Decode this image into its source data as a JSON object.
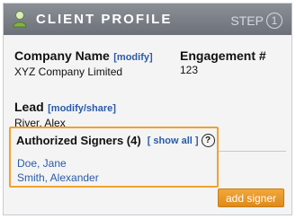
{
  "header": {
    "title": "CLIENT PROFILE",
    "step_label": "STEP",
    "step_number": "1"
  },
  "company": {
    "label": "Company Name",
    "link": "[modify]",
    "value": "XYZ Company Limited"
  },
  "engagement": {
    "label": "Engagement #",
    "value": "123"
  },
  "lead": {
    "label": "Lead",
    "link": "[modify/share]",
    "value": "River, Alex"
  },
  "signers": {
    "label": "Authorized Signers (4)",
    "show_all": "[ show all ]",
    "help": "?",
    "items": [
      "Doe, Jane",
      "Smith, Alexander"
    ]
  },
  "actions": {
    "add_signer": "add signer"
  },
  "colors": {
    "header_bg": "#6c7179",
    "link": "#2b5aa8",
    "accent": "#f0a22e",
    "button": "#e4921f"
  },
  "icons": {
    "header_icon": "user-icon",
    "help_icon": "question-circle-icon"
  }
}
